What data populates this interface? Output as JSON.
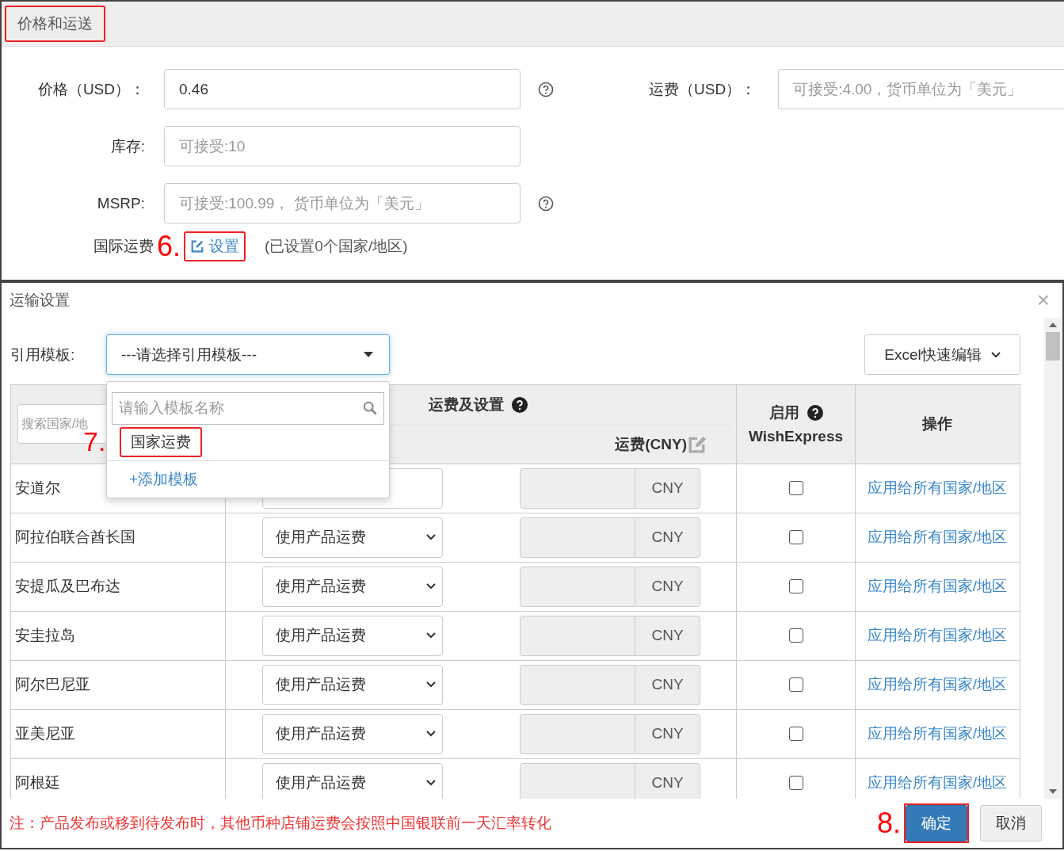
{
  "section": {
    "title": "价格和运送",
    "highlighted": true
  },
  "fields": [
    {
      "label": "价格（USD）：",
      "value": "0.46",
      "help": true
    },
    {
      "label": "库存:",
      "placeholder": "可接受:10",
      "help": false
    },
    {
      "label": "MSRP:",
      "placeholder": "可接受:100.99， 货币单位为「美元」",
      "help": true
    }
  ],
  "shipping_field": {
    "label": "运费（USD）：",
    "placeholder": "可接受:4.00，货币单位为「美元」"
  },
  "intl_shipping": {
    "label": "国际运费",
    "step": "6.",
    "link": "设置",
    "highlighted": true,
    "note": "(已设置0个国家/地区)"
  },
  "dialog": {
    "title": "运输设置",
    "close": "×",
    "template": {
      "label": "引用模板:",
      "value": "---请选择引用模板---",
      "expanded": true,
      "search_placeholder": "请输入模板名称",
      "options": [
        {
          "label": "国家运费",
          "step": "7.",
          "highlighted": true,
          "kind": "option"
        },
        {
          "label": "+添加模板",
          "kind": "action"
        }
      ]
    },
    "excel_button": "Excel快速编辑",
    "table": {
      "search_placeholder": "搜索国家/地",
      "group_header": "运费及设置",
      "fee_header": "运费(CNY)",
      "enable_header": "启用",
      "enable_sub": "WishExpress",
      "ops_header": "操作",
      "rows": [
        {
          "country": "安道尔",
          "option": null,
          "currency": "CNY",
          "checked": false,
          "action": "应用给所有国家/地区"
        },
        {
          "country": "阿拉伯联合酋长国",
          "option": "使用产品运费",
          "currency": "CNY",
          "checked": false,
          "action": "应用给所有国家/地区"
        },
        {
          "country": "安提瓜及巴布达",
          "option": "使用产品运费",
          "currency": "CNY",
          "checked": false,
          "action": "应用给所有国家/地区"
        },
        {
          "country": "安圭拉岛",
          "option": "使用产品运费",
          "currency": "CNY",
          "checked": false,
          "action": "应用给所有国家/地区"
        },
        {
          "country": "阿尔巴尼亚",
          "option": "使用产品运费",
          "currency": "CNY",
          "checked": false,
          "action": "应用给所有国家/地区"
        },
        {
          "country": "亚美尼亚",
          "option": "使用产品运费",
          "currency": "CNY",
          "checked": false,
          "action": "应用给所有国家/地区"
        },
        {
          "country": "阿根廷",
          "option": "使用产品运费",
          "currency": "CNY",
          "checked": false,
          "action": "应用给所有国家/地区"
        }
      ]
    },
    "note": "注：产品发布或移到待发布时，其他币种店铺运费会按照中国银联前一天汇率转化",
    "buttons": [
      {
        "label": "确定",
        "kind": "primary",
        "step": "8.",
        "highlighted": true
      },
      {
        "label": "取消",
        "kind": "default",
        "highlighted": false
      }
    ]
  }
}
